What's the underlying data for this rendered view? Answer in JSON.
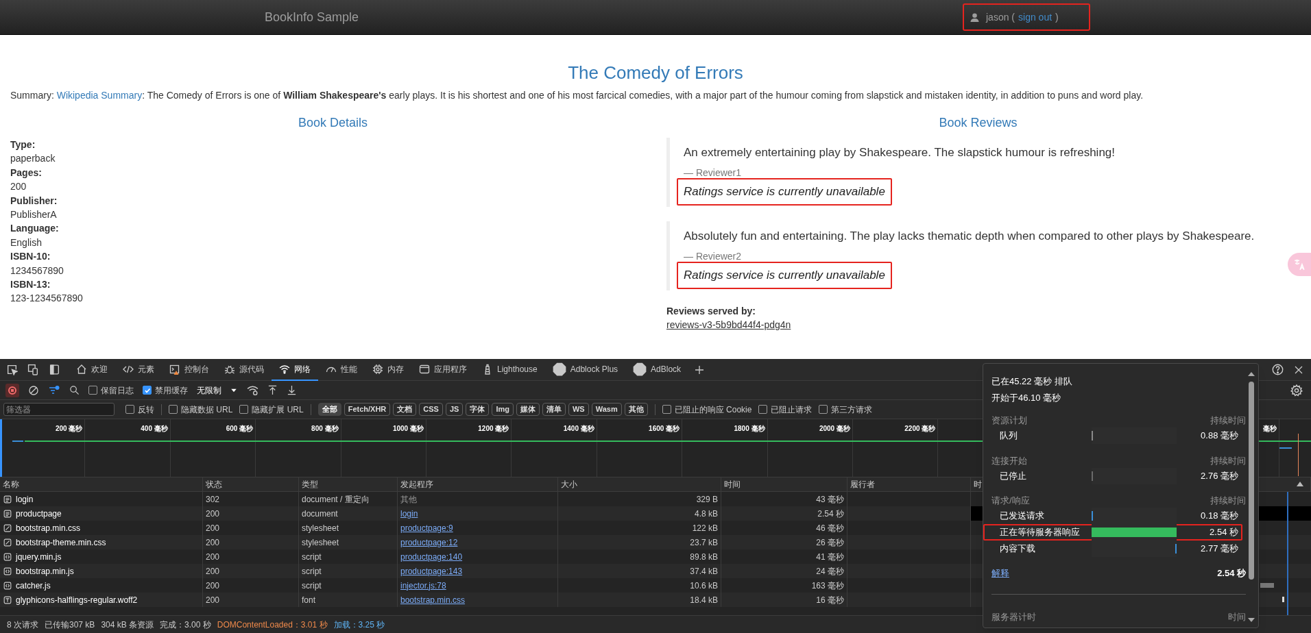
{
  "navbar": {
    "title": "BookInfo Sample",
    "user": {
      "name": "jason (",
      "link": "sign out",
      "close": ")",
      "highlighted": true
    }
  },
  "book": {
    "title": "The Comedy of Errors",
    "summary": {
      "before": "Summary: ",
      "link": "Wikipedia Summary",
      "after": ": The Comedy of Errors is one of **William Shakespeare's** early plays. It is his shortest and one of his most farcical comedies, with a major part of the humour coming from slapstick and mistaken identity, in addition to puns and word play."
    },
    "details": {
      "heading": "Book Details",
      "fields": [
        {
          "label": "Type:",
          "value": "paperback"
        },
        {
          "label": "Pages:",
          "value": "200"
        },
        {
          "label": "Publisher:",
          "value": "PublisherA"
        },
        {
          "label": "Language:",
          "value": "English"
        },
        {
          "label": "ISBN-10:",
          "value": "1234567890"
        },
        {
          "label": "ISBN-13:",
          "value": "123-1234567890"
        }
      ]
    },
    "reviews": {
      "heading": "Book Reviews",
      "items": [
        {
          "text": "An extremely entertaining play by Shakespeare. The slapstick humour is refreshing!",
          "reviewer": "— Reviewer1",
          "rating": "Ratings service is currently unavailable",
          "highlighted": true
        },
        {
          "text": "Absolutely fun and entertaining. The play lacks thematic depth when compared to other plays by Shakespeare.",
          "reviewer": "— Reviewer2",
          "rating": "Ratings service is currently unavailable",
          "highlighted": true
        }
      ],
      "served_by_label": "Reviews served by:",
      "served_by": "reviews-v3-5b9bd44f4-pdg4n"
    }
  },
  "devtools": {
    "tabs": [
      {
        "label": "欢迎",
        "kind": "home",
        "selected": false
      },
      {
        "label": "元素",
        "kind": "code",
        "selected": false
      },
      {
        "label": "控制台",
        "kind": "console",
        "selected": false
      },
      {
        "label": "源代码",
        "kind": "bug",
        "selected": false
      },
      {
        "label": "网络",
        "kind": "wifi",
        "selected": true
      },
      {
        "label": "性能",
        "kind": "gauge",
        "selected": false
      },
      {
        "label": "内存",
        "kind": "chip",
        "selected": false
      },
      {
        "label": "应用程序",
        "kind": "window",
        "selected": false
      },
      {
        "label": "Lighthouse",
        "kind": "lighthouse",
        "selected": false
      },
      {
        "label": "Adblock Plus",
        "kind": "extension",
        "selected": false
      },
      {
        "label": "AdBlock",
        "kind": "extension",
        "selected": false
      }
    ],
    "toolbar": {
      "checkboxes": [
        {
          "label": "保留日志",
          "checked": false
        },
        {
          "label": "禁用缓存",
          "checked": true
        }
      ],
      "throttle": "无限制"
    },
    "filter": {
      "placeholder": "筛选器",
      "options_before": [
        {
          "label": "反转",
          "checked": false
        },
        {
          "label": "隐藏数据 URL",
          "checked": false
        },
        {
          "label": "隐藏扩展 URL",
          "checked": false
        }
      ],
      "types": [
        {
          "label": "全部",
          "selected": true
        },
        {
          "label": "Fetch/XHR",
          "selected": false
        },
        {
          "label": "文档",
          "selected": false
        },
        {
          "label": "CSS",
          "selected": false
        },
        {
          "label": "JS",
          "selected": false
        },
        {
          "label": "字体",
          "selected": false
        },
        {
          "label": "Img",
          "selected": false
        },
        {
          "label": "媒体",
          "selected": false
        },
        {
          "label": "清单",
          "selected": false
        },
        {
          "label": "WS",
          "selected": false
        },
        {
          "label": "Wasm",
          "selected": false
        },
        {
          "label": "其他",
          "selected": false
        }
      ],
      "options_after": [
        {
          "label": "已阻止的响应 Cookie",
          "checked": false
        },
        {
          "label": "已阻止请求",
          "checked": false
        },
        {
          "label": "第三方请求",
          "checked": false
        }
      ]
    },
    "overview": {
      "ticks": [
        "200 毫秒",
        "400 毫秒",
        "600 毫秒",
        "800 毫秒",
        "1000 毫秒",
        "1200 毫秒",
        "1400 毫秒",
        "1600 毫秒",
        "1800 毫秒",
        "2000 毫秒",
        "2200 毫秒"
      ],
      "cut_tick": "毫秒"
    },
    "table": {
      "columns": [
        "名称",
        "状态",
        "类型",
        "发起程序",
        "大小",
        "时间",
        "履行者",
        "时"
      ],
      "rows": [
        {
          "name": "login",
          "kind": "doc",
          "status": "302",
          "type": "document / 重定向",
          "initiator": "其他",
          "initiator_link": false,
          "size": "329 B",
          "time": "43 毫秒",
          "selected": false
        },
        {
          "name": "productpage",
          "kind": "doc",
          "status": "200",
          "type": "document",
          "initiator": "login",
          "initiator_link": true,
          "size": "4.8 kB",
          "time": "2.54 秒",
          "selected": true
        },
        {
          "name": "bootstrap.min.css",
          "kind": "css",
          "status": "200",
          "type": "stylesheet",
          "initiator": "productpage:9",
          "initiator_link": true,
          "size": "122 kB",
          "time": "46 毫秒",
          "selected": false
        },
        {
          "name": "bootstrap-theme.min.css",
          "kind": "css",
          "status": "200",
          "type": "stylesheet",
          "initiator": "productpage:12",
          "initiator_link": true,
          "size": "23.7 kB",
          "time": "26 毫秒",
          "selected": false
        },
        {
          "name": "jquery.min.js",
          "kind": "js",
          "status": "200",
          "type": "script",
          "initiator": "productpage:140",
          "initiator_link": true,
          "size": "89.8 kB",
          "time": "41 毫秒",
          "selected": false
        },
        {
          "name": "bootstrap.min.js",
          "kind": "js",
          "status": "200",
          "type": "script",
          "initiator": "productpage:143",
          "initiator_link": true,
          "size": "37.4 kB",
          "time": "24 毫秒",
          "selected": false
        },
        {
          "name": "catcher.js",
          "kind": "js",
          "status": "200",
          "type": "script",
          "initiator": "injector.js:78",
          "initiator_link": true,
          "size": "10.6 kB",
          "time": "163 毫秒",
          "selected": false
        },
        {
          "name": "glyphicons-halflings-regular.woff2",
          "kind": "typeface",
          "status": "200",
          "type": "font",
          "initiator": "bootstrap.min.css",
          "initiator_link": true,
          "size": "18.4 kB",
          "time": "16 毫秒",
          "selected": false
        }
      ]
    },
    "status_bar": [
      {
        "text": "8 次请求",
        "kind": "plain"
      },
      {
        "text": "已传输307 kB",
        "kind": "plain"
      },
      {
        "text": "304 kB 条资源",
        "kind": "plain"
      },
      {
        "text": "完成：3.00 秒",
        "kind": "plain"
      },
      {
        "text": "DOMContentLoaded：3.01 秒",
        "kind": "dcl"
      },
      {
        "text": "加载：3.25 秒",
        "kind": "load"
      }
    ],
    "timing": {
      "queued": "已在45.22 毫秒 排队",
      "started": "开始于46.10 毫秒",
      "sections": [
        {
          "title": "资源计划",
          "heading": "持续时间",
          "rows": [
            {
              "label": "队列",
              "duration": "0.88 毫秒",
              "kind": "tick-start",
              "color": "#8a8a8a",
              "highlighted": false
            }
          ]
        },
        {
          "title": "连接开始",
          "heading": "持续时间",
          "rows": [
            {
              "label": "已停止",
              "duration": "2.76 毫秒",
              "kind": "tick-start",
              "color": "#6a6a6a",
              "highlighted": false
            }
          ]
        },
        {
          "title": "请求/响应",
          "heading": "持续时间",
          "rows": [
            {
              "label": "已发送请求",
              "duration": "0.18 毫秒",
              "kind": "tick-start",
              "color": "#3a8fd8",
              "highlighted": false
            },
            {
              "label": "正在等待服务器响应",
              "duration": "2.54 秒",
              "kind": "fill",
              "level": 1,
              "color": "#35bb5d",
              "highlighted": true
            },
            {
              "label": "内容下载",
              "duration": "2.77 毫秒",
              "kind": "tick-end",
              "color": "#3a8fd8",
              "highlighted": false
            }
          ]
        }
      ],
      "explain_link": "解释",
      "total": "2.54 秒",
      "server_timing": {
        "title": "服务器计时",
        "heading": "时间"
      }
    }
  }
}
